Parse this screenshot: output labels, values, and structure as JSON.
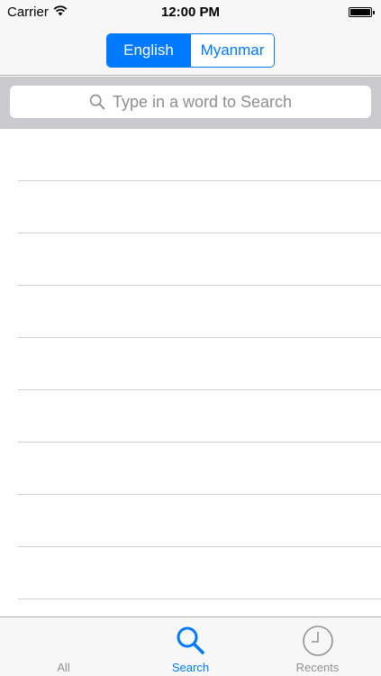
{
  "status_bar": {
    "carrier": "Carrier",
    "time": "12:00 PM",
    "battery_level": 1.0
  },
  "nav": {
    "segments": [
      {
        "label": "English",
        "selected": true
      },
      {
        "label": "Myanmar",
        "selected": false
      }
    ]
  },
  "search": {
    "placeholder": "Type in a word to Search"
  },
  "list": {
    "row_count": 9
  },
  "tabs": [
    {
      "label": "All",
      "icon": "all-icon",
      "active": false
    },
    {
      "label": "Search",
      "icon": "search-icon",
      "active": true
    },
    {
      "label": "Recents",
      "icon": "clock-icon",
      "active": false
    }
  ],
  "colors": {
    "accent": "#007aff",
    "bar_background": "#f7f7f7",
    "search_background": "#c9c9ce",
    "inactive_tab": "#929292",
    "separator": "#d0d0d4"
  }
}
